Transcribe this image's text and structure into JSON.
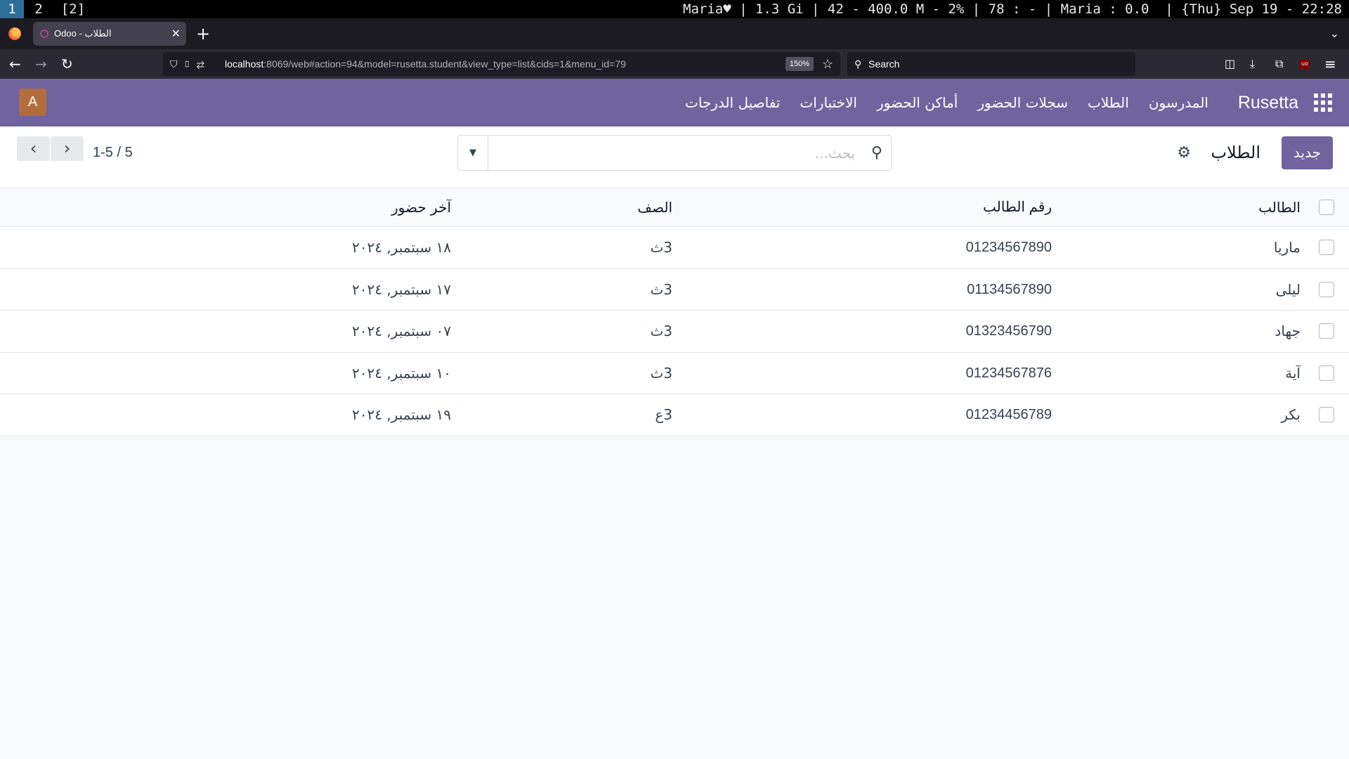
{
  "system_bar": {
    "workspaces": [
      "1",
      "2",
      "[2]"
    ],
    "status": "Maria♥ | 1.3 Gi | 42 - 400.0 M - 2% | 78 : - | Maria : 0.0  | {Thu} Sep 19 - 22:28"
  },
  "browser": {
    "tab_title": "Odoo - الطلاب",
    "new_tab": "+",
    "url_host": "localhost",
    "url_rest": ":8069/web#action=94&model=rusetta.student&view_type=list&cids=1&menu_id=79",
    "zoom": "150%",
    "search_placeholder": "Search"
  },
  "app": {
    "brand": "Rusetta",
    "menu": [
      "المدرسون",
      "الطلاب",
      "سجلات الحضور",
      "أماكن الحضور",
      "الاختبارات",
      "تفاصيل الدرجات"
    ],
    "user_initial": "A",
    "new_button": "جديد",
    "page_title": "الطلاب",
    "search_placeholder": "بحث...",
    "pager": "1-5 / 5",
    "columns": {
      "name": "الطالب",
      "number": "رقم الطالب",
      "class": "الصف",
      "last_attendance": "آخر حضور"
    },
    "rows": [
      {
        "name": "ماريا",
        "number": "01234567890",
        "class": "3ث",
        "last": "١٨ سبتمبر, ٢٠٢٤"
      },
      {
        "name": "ليلى",
        "number": "01134567890",
        "class": "3ث",
        "last": "١٧ سبتمبر, ٢٠٢٤"
      },
      {
        "name": "جهاد",
        "number": "01323456790",
        "class": "3ث",
        "last": "٠٧ سبتمبر, ٢٠٢٤"
      },
      {
        "name": "آية",
        "number": "01234567876",
        "class": "3ث",
        "last": "١٠ سبتمبر, ٢٠٢٤"
      },
      {
        "name": "بكر",
        "number": "01234456789",
        "class": "3ع",
        "last": "١٩ سبتمبر, ٢٠٢٤"
      }
    ]
  },
  "colors": {
    "brand_purple": "#71639e",
    "avatar": "#b36d3d"
  }
}
